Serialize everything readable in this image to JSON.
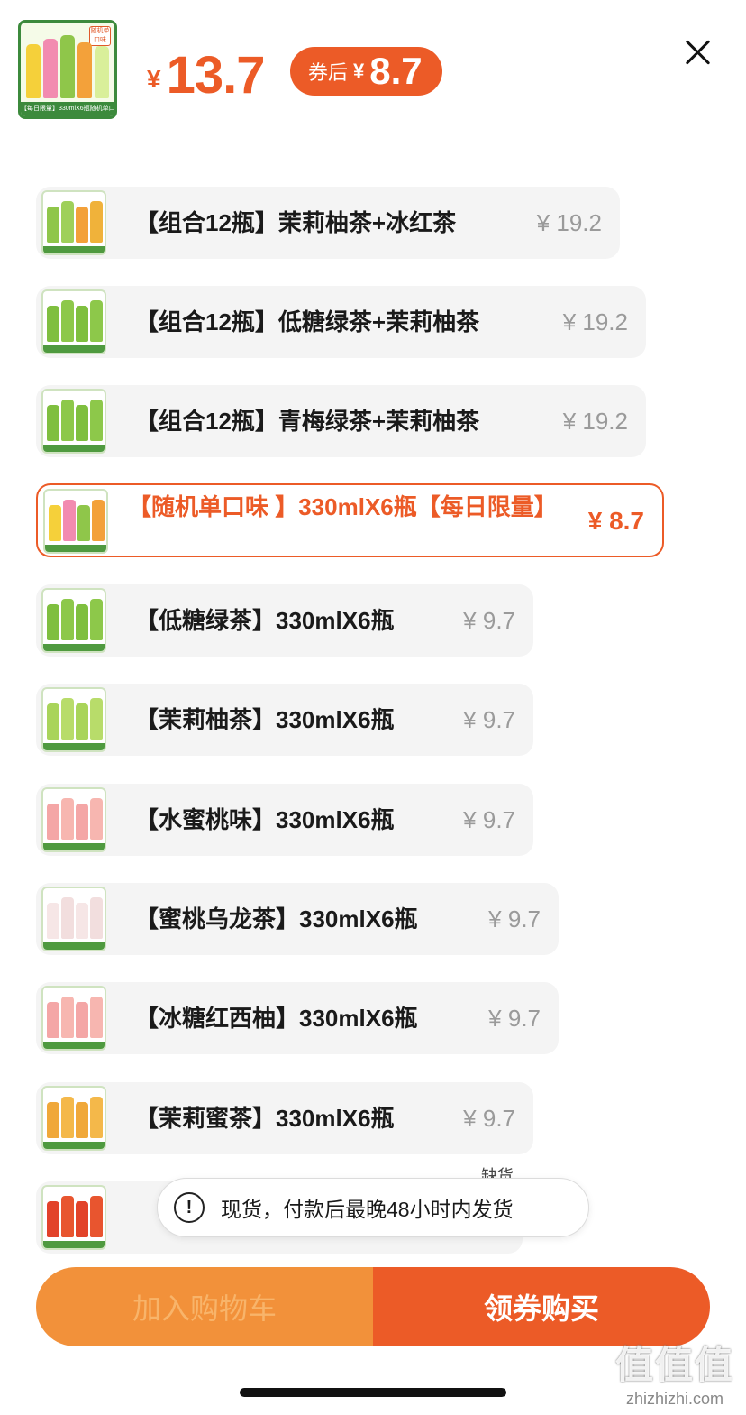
{
  "header": {
    "product_thumb_caption": "【每日限量】330mlX6瓶随机单口味",
    "product_thumb_tag": "随机单口味",
    "price_currency": "¥",
    "price": "13.7",
    "coupon_label": "券后",
    "coupon_currency": "¥",
    "coupon_price": "8.7"
  },
  "options": [
    {
      "name": "【组合12瓶】茉莉柚茶+冰红茶",
      "price": "¥ 19.2",
      "thumb": "mix-orange"
    },
    {
      "name": "【组合12瓶】低糖绿茶+茉莉柚茶",
      "price": "¥ 19.2",
      "thumb": "green"
    },
    {
      "name": "【组合12瓶】青梅绿茶+茉莉柚茶",
      "price": "¥ 19.2",
      "thumb": "green"
    },
    {
      "name": "【随机单口味 】330mlX6瓶【每日限量】",
      "price": "¥ 8.7",
      "thumb": "mixed",
      "selected": true
    },
    {
      "name": "【低糖绿茶】330mlX6瓶",
      "price": "¥ 9.7",
      "thumb": "green"
    },
    {
      "name": "【茉莉柚茶】330mlX6瓶",
      "price": "¥ 9.7",
      "thumb": "lightgreen"
    },
    {
      "name": "【水蜜桃味】330mlX6瓶",
      "price": "¥ 9.7",
      "thumb": "pink"
    },
    {
      "name": "【蜜桃乌龙茶】330mlX6瓶",
      "price": "¥ 9.7",
      "thumb": "white"
    },
    {
      "name": "【冰糖红西柚】330mlX6瓶",
      "price": "¥ 9.7",
      "thumb": "pink"
    },
    {
      "name": "【茉莉蜜茶】330mlX6瓶",
      "price": "¥ 9.7",
      "thumb": "orange"
    },
    {
      "name": "",
      "price": "",
      "thumb": "red"
    }
  ],
  "peek_text": "缺货",
  "toast": {
    "icon": "!",
    "text": "现货，付款后最晚48小时内发货"
  },
  "buttons": {
    "add_cart": "加入购物车",
    "buy": "领券购买"
  },
  "watermark": {
    "brand": "值值值",
    "url": "zhizhizhi.com"
  },
  "colors": {
    "accent": "#ec5b27",
    "cart": "#f2913a",
    "option_bg": "#f4f4f4"
  }
}
